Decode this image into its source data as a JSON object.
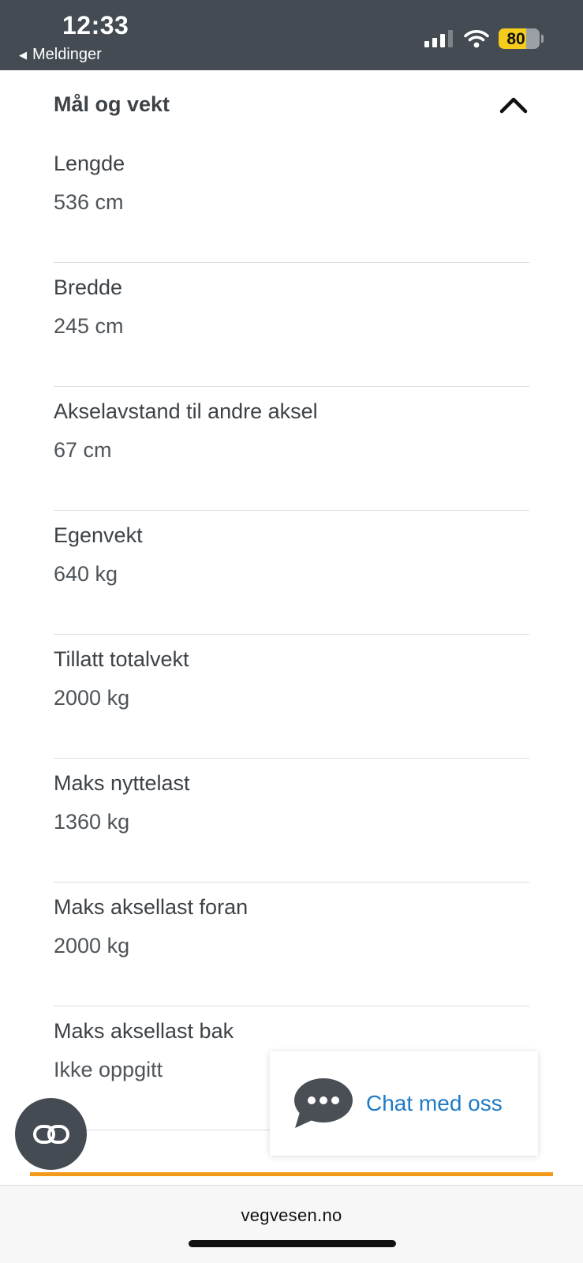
{
  "status_bar": {
    "time": "12:33",
    "back_label": "Meldinger",
    "battery_level": "80",
    "battery_color": "#f5cc1a"
  },
  "section": {
    "title": "Mål og vekt",
    "toggle_icon": "chevron-up-icon"
  },
  "specs": [
    {
      "label": "Lengde",
      "value": "536 cm"
    },
    {
      "label": "Bredde",
      "value": "245 cm"
    },
    {
      "label": "Akselavstand til andre aksel",
      "value": "67 cm"
    },
    {
      "label": "Egenvekt",
      "value": "640 kg"
    },
    {
      "label": "Tillatt totalvekt",
      "value": "2000 kg"
    },
    {
      "label": "Maks nyttelast",
      "value": "1360 kg"
    },
    {
      "label": "Maks aksellast foran",
      "value": "2000 kg"
    },
    {
      "label": "Maks aksellast bak",
      "value": "Ikke oppgitt"
    }
  ],
  "chat": {
    "label": "Chat med oss",
    "icon": "chat-bubble-icon",
    "link_color": "#1e7bc7"
  },
  "floating_button": {
    "icon": "link-icon"
  },
  "colors": {
    "accent_line": "#f39a1a",
    "header_bg": "#444b53"
  },
  "browser": {
    "url": "vegvesen.no"
  }
}
